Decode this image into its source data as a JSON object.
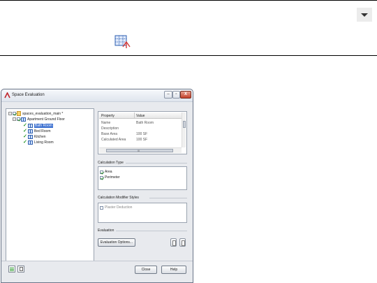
{
  "ribbon": {
    "dropdown_icon": "triangle-down-icon",
    "tool_icon": "space-evaluation-grid-icon"
  },
  "dialog": {
    "title": "Space Evaluation",
    "window_buttons": {
      "minimize": "–",
      "maximize": "▫",
      "close": "X"
    },
    "tree": {
      "root": "spaces_evaluation_main *",
      "floor": "Apartment Ground Floor",
      "rooms": [
        "Bath Room",
        "Bed Room",
        "Kitchen",
        "Living Room"
      ],
      "selected_room": "Bath Room"
    },
    "properties": {
      "headers": [
        "Property",
        "Value"
      ],
      "rows": [
        {
          "property": "Name",
          "value": "Bath Room"
        },
        {
          "property": "Description",
          "value": ""
        },
        {
          "property": "Base Area",
          "value": "100 SF"
        },
        {
          "property": "Calculated Area",
          "value": "100 SF"
        }
      ],
      "scroll_mark": "III"
    },
    "calculation_type": {
      "label": "Calculation Type",
      "options": [
        {
          "label": "Area",
          "checked": true
        },
        {
          "label": "Perimeter",
          "checked": true
        }
      ]
    },
    "modifier_styles": {
      "label": "Calculation Modifier Styles",
      "options": [
        {
          "label": "Plaster Deduction",
          "checked": false
        }
      ]
    },
    "evaluation": {
      "label": "Evaluation",
      "options_button": "Evaluation Options..."
    },
    "buttons": {
      "close": "Close",
      "help": "Help"
    },
    "colors": {
      "selection": "#3a6fd0",
      "check": "#2c9a2c",
      "close_button": "#c4412a"
    }
  }
}
